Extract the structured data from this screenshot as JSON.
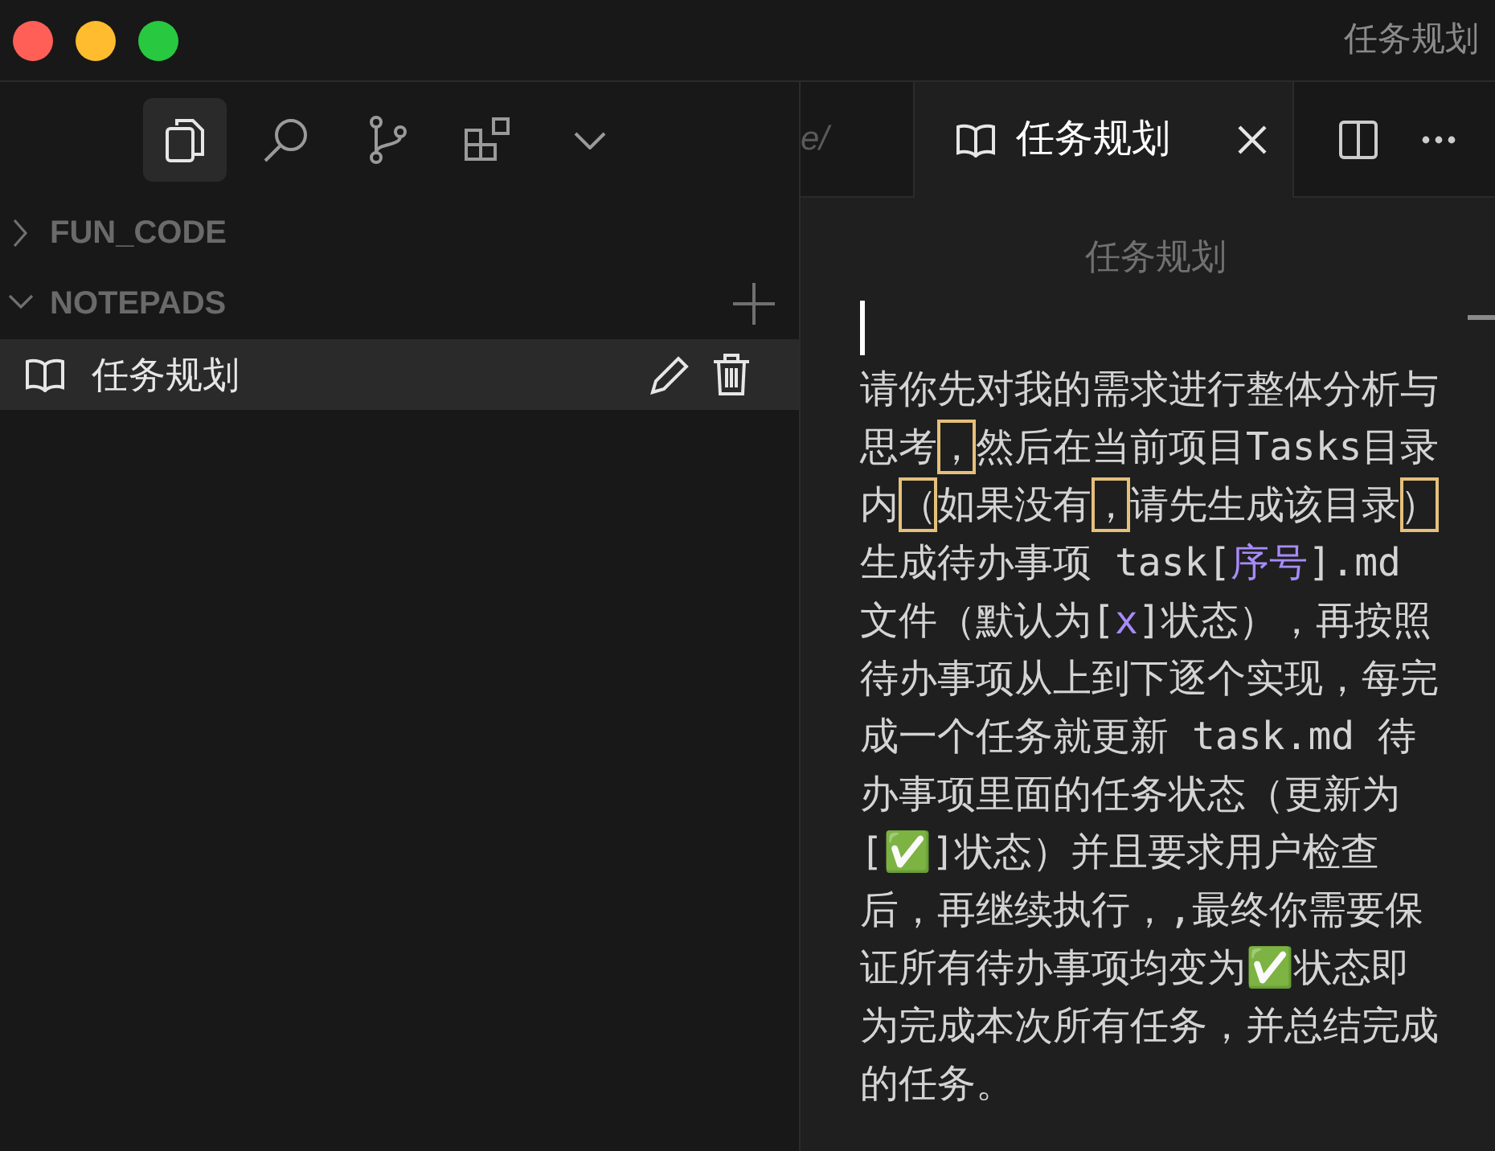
{
  "window": {
    "title": "任务规划"
  },
  "activity_bar": [
    {
      "kind": "explorer",
      "selected": true
    },
    {
      "kind": "search",
      "selected": false
    },
    {
      "kind": "source-control",
      "selected": false
    },
    {
      "kind": "extensions",
      "selected": false
    },
    {
      "kind": "more",
      "selected": false
    }
  ],
  "sidebar": {
    "sections": [
      {
        "label": "FUN_CODE",
        "expanded": false
      },
      {
        "label": "NOTEPADS",
        "expanded": true,
        "items": [
          {
            "label": "任务规划",
            "selected": true
          }
        ]
      }
    ]
  },
  "tabs": [
    {
      "label": "e/",
      "selected": false
    },
    {
      "label": "任务规划",
      "selected": true
    }
  ],
  "editor": {
    "title": "任务规划",
    "runs": [
      {
        "kind": "text",
        "text": "请你先对我的需求进行整体分析与思考"
      },
      {
        "kind": "ambiguous",
        "text": "，"
      },
      {
        "kind": "text",
        "text": "然后在当前项目Tasks目录内"
      },
      {
        "kind": "ambiguous",
        "text": "（"
      },
      {
        "kind": "text",
        "text": "如果没有"
      },
      {
        "kind": "ambiguous",
        "text": "，"
      },
      {
        "kind": "text",
        "text": "请先生成该目录"
      },
      {
        "kind": "ambiguous",
        "text": "）"
      },
      {
        "kind": "text",
        "text": "生成待办事项 task["
      },
      {
        "kind": "token",
        "text": "序号"
      },
      {
        "kind": "text",
        "text": "].md 文件（默认为["
      },
      {
        "kind": "token",
        "text": "x"
      },
      {
        "kind": "text",
        "text": "]状态），再按照待办事项从上到下逐个实现，每完成一个任务就更新 task.md 待办事项里面的任务状态（更新为[✅]状态）并且要求用户检查后，再继续执行，,最终你需要保证所有待办事项均变为✅状态即为完成本次所有任务，并总结完成的任务。"
      }
    ]
  }
}
